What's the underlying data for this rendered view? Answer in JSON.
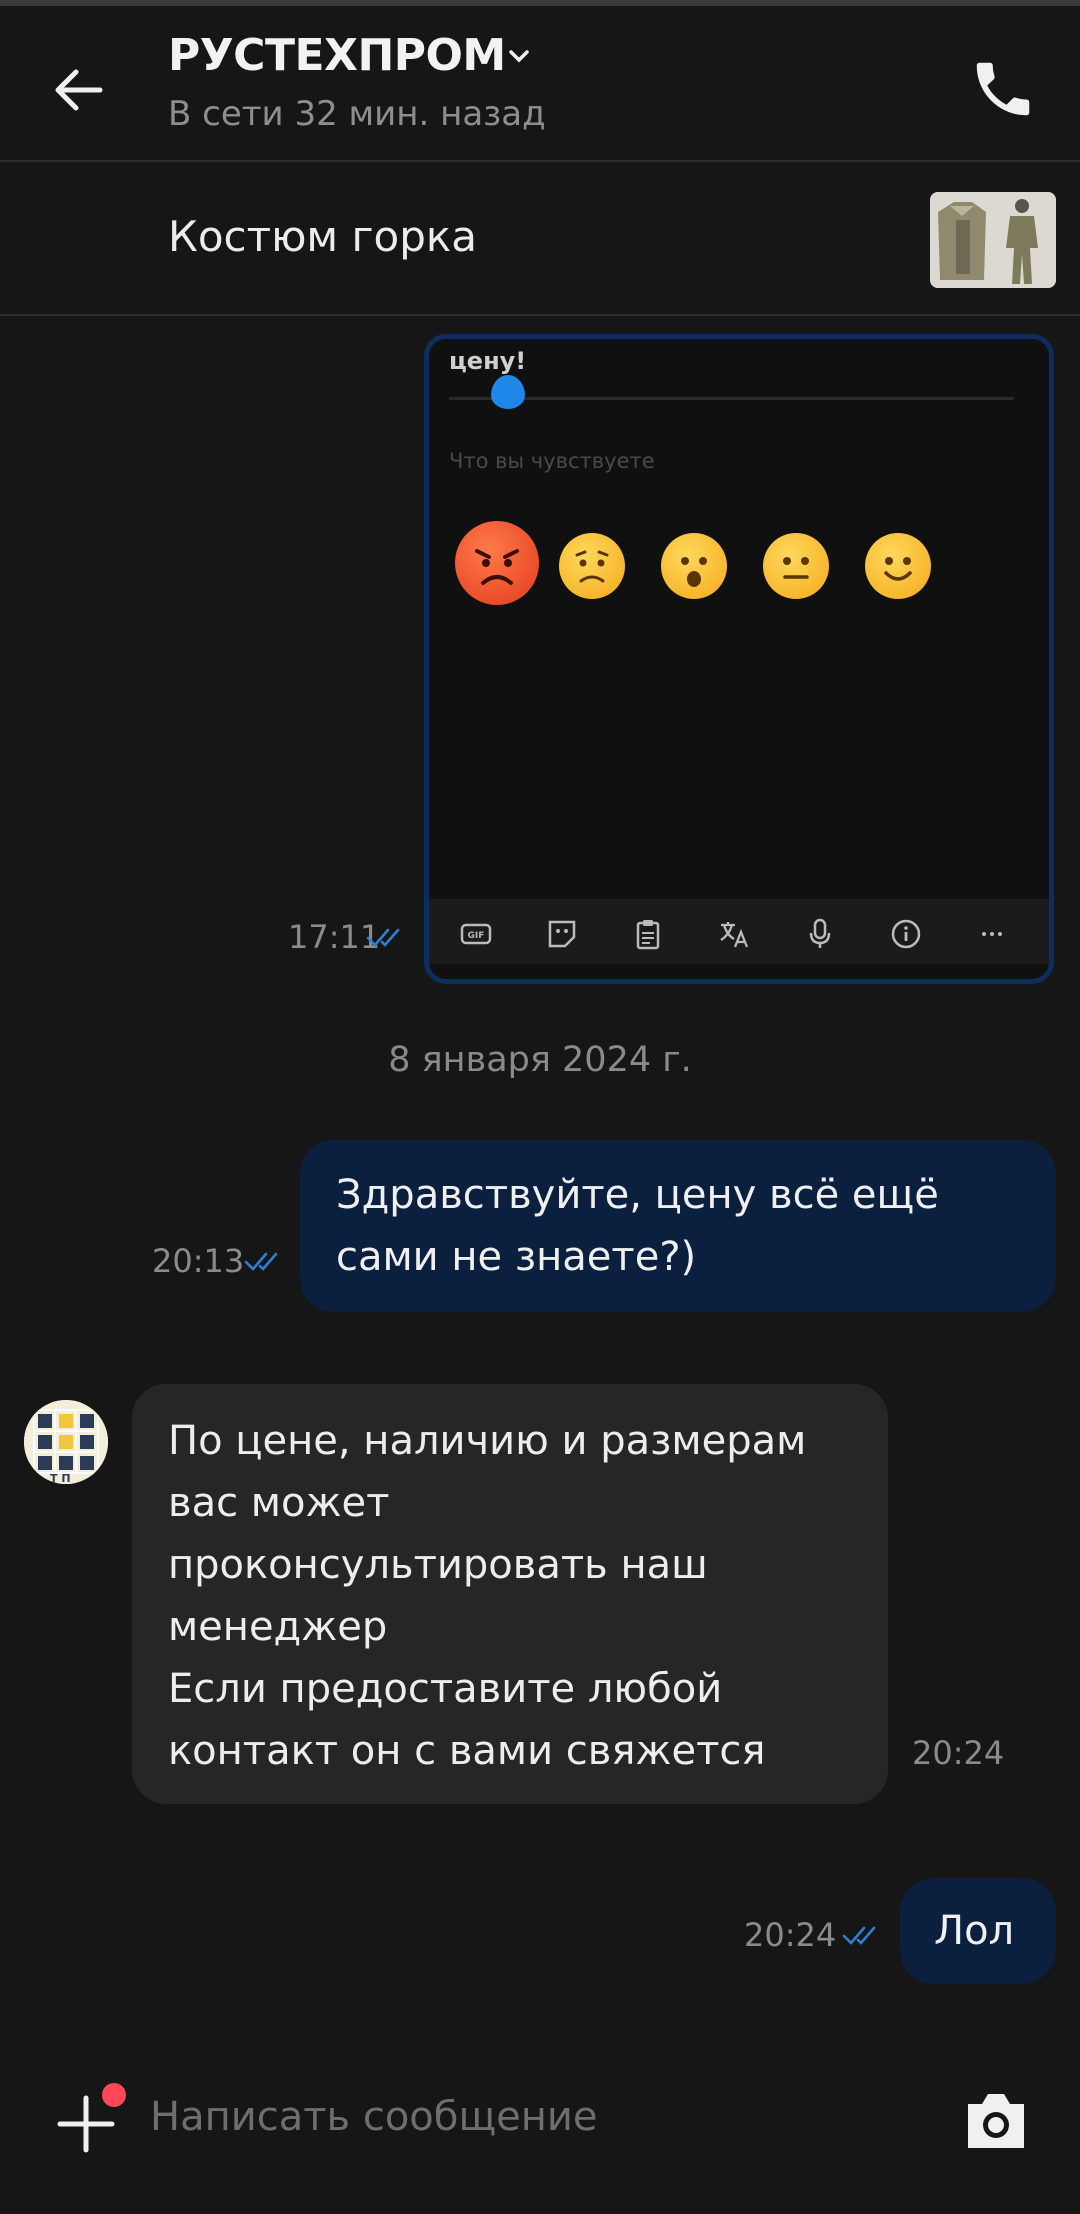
{
  "header": {
    "title": "РУСТЕХПРОМ",
    "status": "В сети 32 мин. назад"
  },
  "product": {
    "name": "Костюм горка"
  },
  "embedded_screenshot": {
    "top_text": "цену!",
    "feel_label": "Что вы чувствуете"
  },
  "messages": [
    {
      "id": "m1",
      "type": "outgoing-image",
      "time": "17:11"
    },
    {
      "id": "m2",
      "type": "outgoing",
      "text_lines": [
        "Здравствуйте, цену всё ещё",
        "сами не знаете?)"
      ],
      "time": "20:13"
    },
    {
      "id": "m3",
      "type": "incoming",
      "text_lines": [
        "По цене, наличию и размерам",
        "вас может",
        "проконсультировать наш",
        "менеджер",
        "Если предоставите любой",
        "контакт он с вами свяжется"
      ],
      "time": "20:24"
    },
    {
      "id": "m4",
      "type": "outgoing",
      "text_lines": [
        "Лол"
      ],
      "time": "20:24"
    }
  ],
  "date_separator": "8 января 2024 г.",
  "composer": {
    "placeholder": "Написать сообщение"
  },
  "colors": {
    "background": "#161616",
    "outgoing_bubble": "#0b1f3f",
    "incoming_bubble": "#262626",
    "ticks": "#2f7fd8",
    "notification_dot": "#ff4757"
  }
}
